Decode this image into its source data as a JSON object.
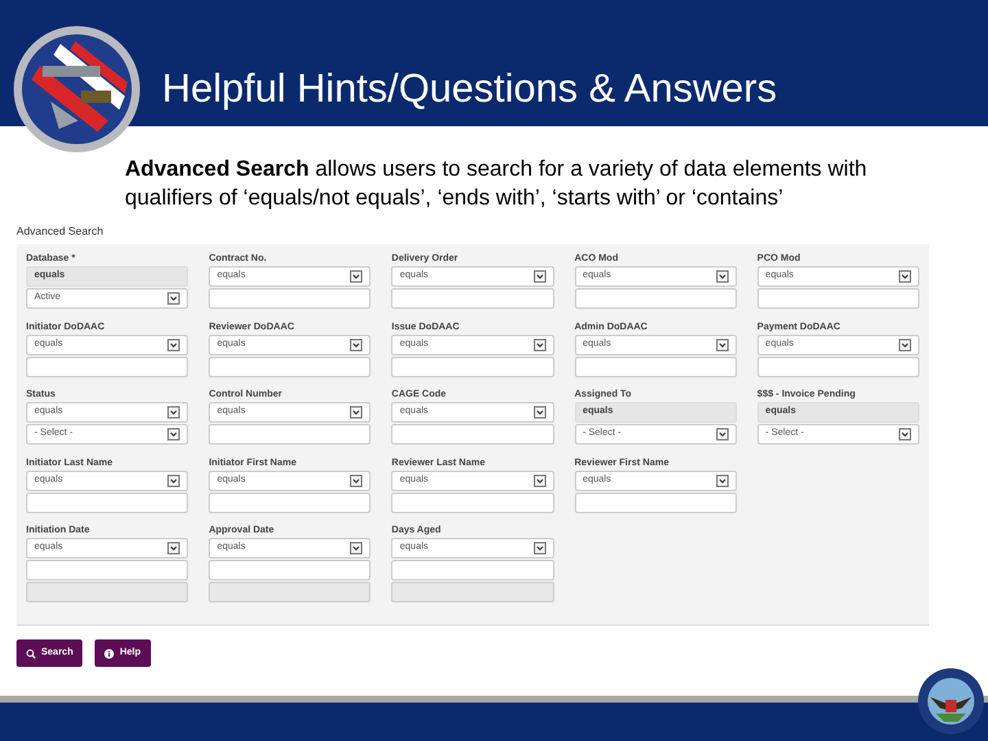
{
  "slide": {
    "title": "Helpful Hints/Questions & Answers",
    "intro": "**Advanced Search** allows users to search for a variety of data elements with qualifiers of ‘equals/not equals’, ‘ends with’, ‘starts with’ or ‘contains’"
  },
  "form": {
    "title": "Advanced Search",
    "rows": [
      [
        {
          "label": "Database *",
          "controls": [
            {
              "kind": "fixed",
              "value": "equals"
            },
            {
              "kind": "select",
              "value": "Active"
            }
          ]
        },
        {
          "label": "Contract No.",
          "controls": [
            {
              "kind": "select",
              "value": "equals"
            },
            {
              "kind": "input"
            }
          ]
        },
        {
          "label": "Delivery Order",
          "controls": [
            {
              "kind": "select",
              "value": "equals"
            },
            {
              "kind": "input"
            }
          ]
        },
        {
          "label": "ACO Mod",
          "controls": [
            {
              "kind": "select",
              "value": "equals"
            },
            {
              "kind": "input"
            }
          ]
        },
        {
          "label": "PCO Mod",
          "controls": [
            {
              "kind": "select",
              "value": "equals"
            },
            {
              "kind": "input"
            }
          ]
        }
      ],
      [
        {
          "label": "Initiator DoDAAC",
          "controls": [
            {
              "kind": "select",
              "value": "equals"
            },
            {
              "kind": "input"
            }
          ]
        },
        {
          "label": "Reviewer DoDAAC",
          "controls": [
            {
              "kind": "select",
              "value": "equals"
            },
            {
              "kind": "input"
            }
          ]
        },
        {
          "label": "Issue DoDAAC",
          "controls": [
            {
              "kind": "select",
              "value": "equals"
            },
            {
              "kind": "input"
            }
          ]
        },
        {
          "label": "Admin DoDAAC",
          "controls": [
            {
              "kind": "select",
              "value": "equals"
            },
            {
              "kind": "input"
            }
          ]
        },
        {
          "label": "Payment DoDAAC",
          "controls": [
            {
              "kind": "select",
              "value": "equals"
            },
            {
              "kind": "input"
            }
          ]
        }
      ],
      [
        {
          "label": "Status",
          "controls": [
            {
              "kind": "select",
              "value": "equals"
            },
            {
              "kind": "select",
              "value": "- Select -"
            }
          ]
        },
        {
          "label": "Control Number",
          "controls": [
            {
              "kind": "select",
              "value": "equals"
            },
            {
              "kind": "input"
            }
          ]
        },
        {
          "label": "CAGE Code",
          "controls": [
            {
              "kind": "select",
              "value": "equals"
            },
            {
              "kind": "input"
            }
          ]
        },
        {
          "label": "Assigned To",
          "controls": [
            {
              "kind": "fixed",
              "value": "equals"
            },
            {
              "kind": "select",
              "value": "- Select -"
            }
          ]
        },
        {
          "label": "$$$ - Invoice Pending",
          "controls": [
            {
              "kind": "fixed",
              "value": "equals"
            },
            {
              "kind": "select",
              "value": "- Select -"
            }
          ]
        }
      ],
      [
        {
          "label": "Initiator Last Name",
          "controls": [
            {
              "kind": "select",
              "value": "equals"
            },
            {
              "kind": "input"
            }
          ]
        },
        {
          "label": "Initiator First Name",
          "controls": [
            {
              "kind": "select",
              "value": "equals"
            },
            {
              "kind": "input"
            }
          ]
        },
        {
          "label": "Reviewer Last Name",
          "controls": [
            {
              "kind": "select",
              "value": "equals"
            },
            {
              "kind": "input"
            }
          ]
        },
        {
          "label": "Reviewer First Name",
          "controls": [
            {
              "kind": "select",
              "value": "equals"
            },
            {
              "kind": "input"
            }
          ]
        }
      ],
      [
        {
          "label": "Initiation Date",
          "controls": [
            {
              "kind": "select",
              "value": "equals"
            },
            {
              "kind": "input"
            },
            {
              "kind": "disabled"
            }
          ]
        },
        {
          "label": "Approval Date",
          "controls": [
            {
              "kind": "select",
              "value": "equals"
            },
            {
              "kind": "input"
            },
            {
              "kind": "disabled"
            }
          ]
        },
        {
          "label": "Days Aged",
          "controls": [
            {
              "kind": "select",
              "value": "equals"
            },
            {
              "kind": "input"
            },
            {
              "kind": "disabled"
            }
          ]
        }
      ]
    ],
    "buttons": [
      {
        "kind": "search",
        "label": "Search"
      },
      {
        "kind": "help",
        "label": "Help"
      }
    ]
  }
}
